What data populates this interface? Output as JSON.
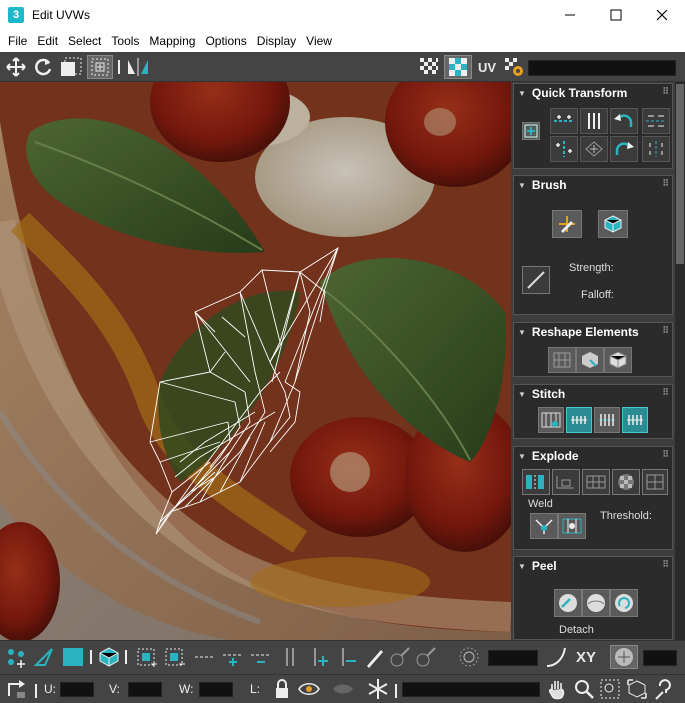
{
  "window": {
    "title": "Edit UVWs",
    "app_icon": "3"
  },
  "menu": [
    "File",
    "Edit",
    "Select",
    "Tools",
    "Mapping",
    "Options",
    "Display",
    "View"
  ],
  "toolbar": {
    "uv_label": "UV"
  },
  "panel": {
    "quick_transform": {
      "title": "Quick Transform"
    },
    "brush": {
      "title": "Brush",
      "strength_label": "Strength:",
      "falloff_label": "Falloff:"
    },
    "reshape": {
      "title": "Reshape Elements"
    },
    "stitch": {
      "title": "Stitch"
    },
    "explode": {
      "title": "Explode",
      "weld_label": "Weld",
      "threshold_label": "Threshold:"
    },
    "peel": {
      "title": "Peel",
      "detach_label": "Detach"
    }
  },
  "bottom": {
    "xy_label": "XY",
    "u_label": "U:",
    "v_label": "V:",
    "w_label": "W:",
    "l_label": "L:"
  },
  "colors": {
    "accent": "#1fb8c8",
    "teal_button": "#2c8c94",
    "panel_bg": "#2b2b2b"
  }
}
